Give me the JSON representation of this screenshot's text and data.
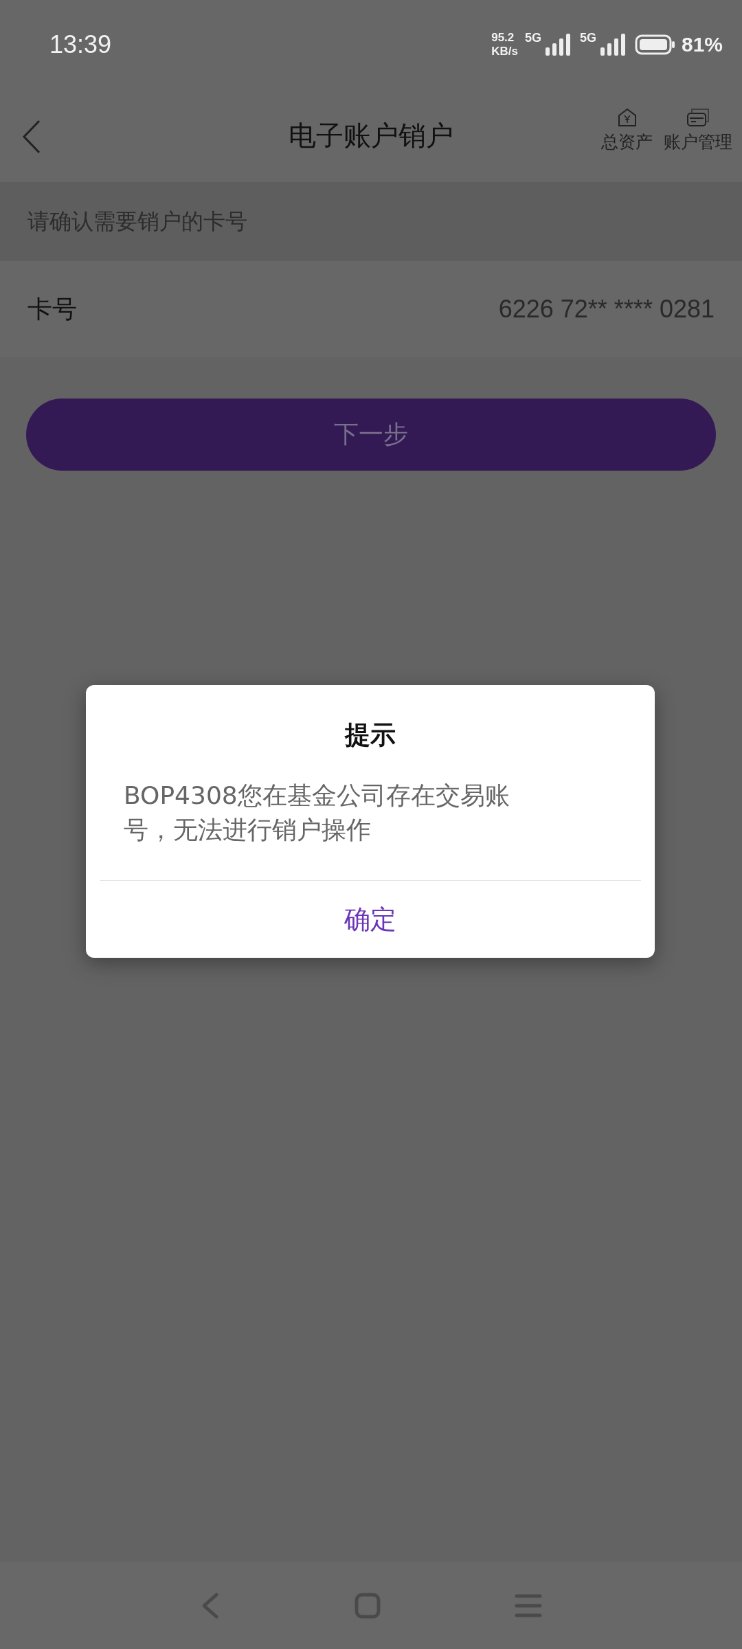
{
  "status_bar": {
    "time": "13:39",
    "net_speed_value": "95.2",
    "net_speed_unit": "KB/s",
    "sim1_network": "5G",
    "sim2_network": "5G",
    "battery": "81%"
  },
  "header": {
    "title": "电子账户销户",
    "actions": [
      {
        "label": "总资产",
        "kind": "assets"
      },
      {
        "label": "账户管理",
        "kind": "manage"
      }
    ]
  },
  "section_hint": "请确认需要销户的卡号",
  "card_row": {
    "label": "卡号",
    "value": "6226 72** **** 0281"
  },
  "next_button": {
    "label": "下一步",
    "disabled": true
  },
  "dialog": {
    "title": "提示",
    "message": "BOP4308您在基金公司存在交易账号，无法进行销户操作",
    "confirm": "确定"
  }
}
